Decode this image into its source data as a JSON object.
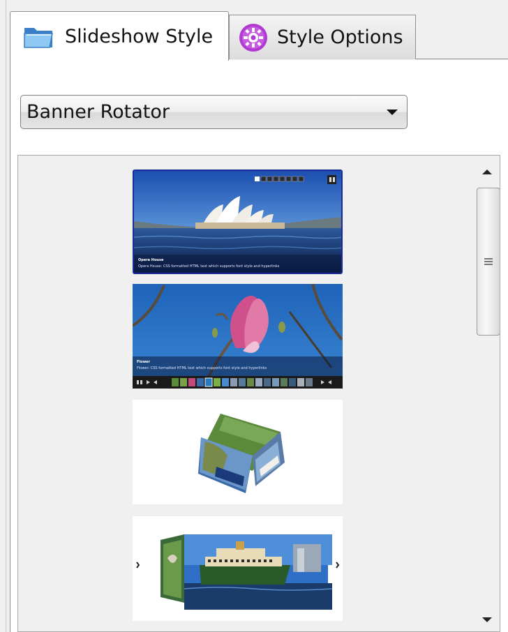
{
  "tabs": [
    {
      "label": "Slideshow Style",
      "icon": "folder-icon",
      "active": true
    },
    {
      "label": "Style Options",
      "icon": "gear-icon",
      "active": false
    }
  ],
  "style_select": {
    "value": "Banner Rotator"
  },
  "thumbnails": [
    {
      "caption_title": "Opera House",
      "caption_text": "Opera House: CSS formatted HTML text which supports font style and hyperlinks"
    },
    {
      "caption_title": "Flower",
      "caption_text": "Flower: CSS formatted HTML text which supports font style and hyperlinks"
    },
    {
      "caption_title": "",
      "caption_text": ""
    },
    {
      "caption_title": "",
      "caption_text": ""
    }
  ],
  "thumb1_pager": [
    "1",
    "2",
    "3",
    "4",
    "5",
    "6",
    "7",
    "8"
  ],
  "colors": {
    "active_thumb_border": "#1a2a9a",
    "tab_icon_gear": "#b03ad0",
    "tab_icon_folder": "#4a9ad8"
  }
}
